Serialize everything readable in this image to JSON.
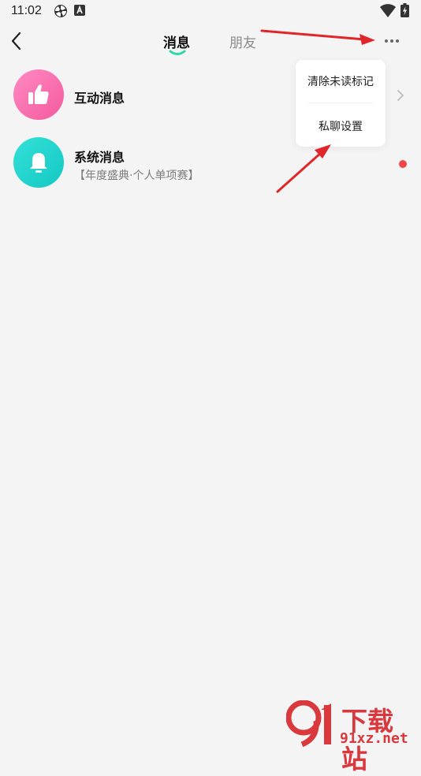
{
  "status_bar": {
    "time": "11:02",
    "notification_icons": [
      "pinwheel-icon",
      "a-badge-icon"
    ],
    "system_icons": [
      "wifi-icon",
      "battery-charging-icon"
    ]
  },
  "top_nav": {
    "tabs": [
      {
        "label": "消息",
        "active": true
      },
      {
        "label": "朋友",
        "active": false
      }
    ],
    "accent_color": "#2bd9a6"
  },
  "conversations": [
    {
      "title": "互动消息",
      "subtitle": "",
      "icon": "thumbs-up-icon",
      "avatar_color": "#f45b9e",
      "unread": false
    },
    {
      "title": "系统消息",
      "subtitle": "【年度盛典·个人单项赛】",
      "icon": "bell-icon",
      "avatar_color": "#15c8c3",
      "unread": true
    }
  ],
  "popup_menu": {
    "items": [
      {
        "label": "清除未读标记"
      },
      {
        "label": "私聊设置"
      }
    ]
  },
  "annotation_color": "#e0262a",
  "watermark": {
    "logo_text": "9",
    "cn": "下载站",
    "url": "91xz.net",
    "color": "#d9383c"
  }
}
